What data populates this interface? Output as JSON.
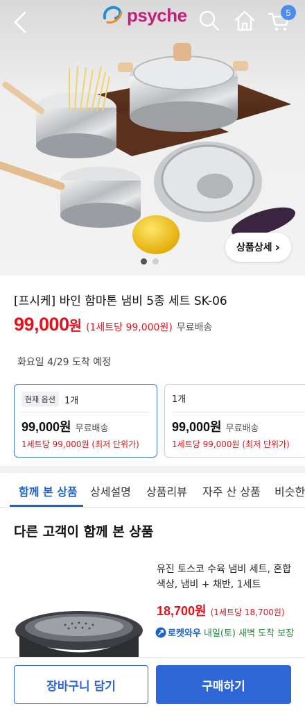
{
  "header": {
    "logo_text": "psyche",
    "cart_count": "5"
  },
  "hero": {
    "detail_button_label": "상품상세",
    "detail_button_chevron": "›",
    "slide_current": 1,
    "slide_total": 2
  },
  "product": {
    "title": "[프시케] 바인 함마톤 냄비 5종 세트 SK-06",
    "price": "99,000",
    "price_currency": "원",
    "unit_price": "(1세트당 99,000원)",
    "shipping": "무료배송",
    "delivery_estimate": "화요일 4/29 도착 예정"
  },
  "options": [
    {
      "tag": "현재 옵션",
      "quantity": "1개",
      "price": "99,000원",
      "shipping": "무료배송",
      "unit_note": "1세트당 99,000원 (최저 단위가)",
      "selected": true
    },
    {
      "tag": "",
      "quantity": "1개",
      "price": "99,000원",
      "shipping": "무료배송",
      "unit_note": "1세트당 99,000원 (최저 단위가)",
      "selected": false
    }
  ],
  "tabs": [
    {
      "label": "함께 본 상품",
      "active": true
    },
    {
      "label": "상세설명",
      "active": false
    },
    {
      "label": "상품리뷰",
      "active": false
    },
    {
      "label": "자주 산 상품",
      "active": false
    },
    {
      "label": "비슷한",
      "active": false
    }
  ],
  "recommendations": {
    "section_title": "다른 고객이 함께 본 상품",
    "items": [
      {
        "name": "유진 토스코 수육 냄비 세트, 혼합색상, 냄비 + 채반, 1세트",
        "price": "18,700원",
        "unit_price": "(1세트당 18,700원)",
        "delivery_badge": "로켓와우",
        "delivery_text": "내일(토) 새벽 도착 보장"
      }
    ]
  },
  "bottom_bar": {
    "cart_button": "장바구니 담기",
    "buy_button": "구매하기"
  },
  "colors": {
    "price_red": "#e3121b",
    "primary_blue": "#2f66d6",
    "logo_magenta": "#c2227a",
    "rocket_green": "#1e8a3a"
  },
  "icons": [
    "back-arrow-icon",
    "search-icon",
    "home-icon",
    "cart-icon",
    "chevron-right-icon",
    "rocket-wow-icon"
  ]
}
